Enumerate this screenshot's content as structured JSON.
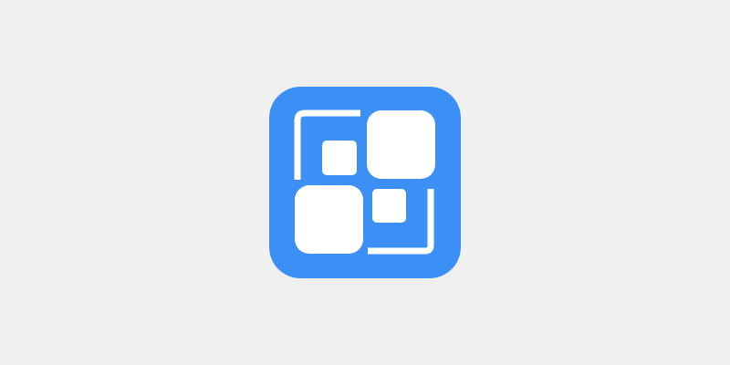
{
  "colors": {
    "background": "#f0f0f0",
    "icon_background": "#3c8ff5",
    "glyph": "#ffffff"
  },
  "app_icon": {
    "name": "app-icon",
    "glyph": "squares-in-brackets-icon"
  }
}
